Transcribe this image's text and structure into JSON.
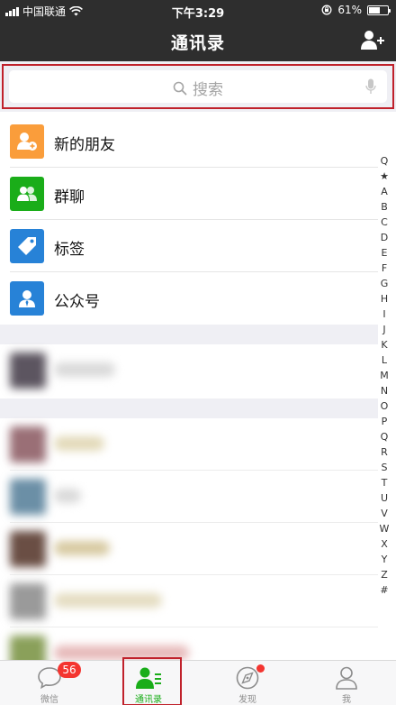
{
  "status_bar": {
    "carrier": "中国联通",
    "time": "下午3:29",
    "battery_percent": "61%",
    "battery_level": 0.61,
    "wifi_icon": "wifi-icon",
    "lock_icon": "rotation-lock-icon"
  },
  "header": {
    "title": "通讯录",
    "add_contact_icon": "add-contact-icon"
  },
  "search": {
    "placeholder": "搜索",
    "search_icon": "search-icon",
    "mic_icon": "microphone-icon"
  },
  "contacts_menu": [
    {
      "label": "新的朋友",
      "icon": "new-friend-icon",
      "color": "#fa9d3b"
    },
    {
      "label": "群聊",
      "icon": "group-chat-icon",
      "color": "#1aad19"
    },
    {
      "label": "标签",
      "icon": "tag-icon",
      "color": "#2782d7"
    },
    {
      "label": "公众号",
      "icon": "official-account-icon",
      "color": "#2782d7"
    }
  ],
  "index_bar": [
    "Q",
    "★",
    "A",
    "B",
    "C",
    "D",
    "E",
    "F",
    "G",
    "H",
    "I",
    "J",
    "K",
    "L",
    "M",
    "N",
    "O",
    "P",
    "Q",
    "R",
    "S",
    "T",
    "U",
    "V",
    "W",
    "X",
    "Y",
    "Z",
    "#"
  ],
  "tab_bar": {
    "tabs": [
      {
        "label": "微信",
        "icon": "chat-icon",
        "badge": "56"
      },
      {
        "label": "通讯录",
        "icon": "contacts-icon",
        "active": true
      },
      {
        "label": "发现",
        "icon": "compass-icon",
        "dot": true
      },
      {
        "label": "我",
        "icon": "profile-icon"
      }
    ]
  },
  "colors": {
    "nav_background": "#2e2e2e",
    "accent_green": "#1aad19",
    "badge_red": "#f43530",
    "highlight_red": "#c0212b"
  }
}
